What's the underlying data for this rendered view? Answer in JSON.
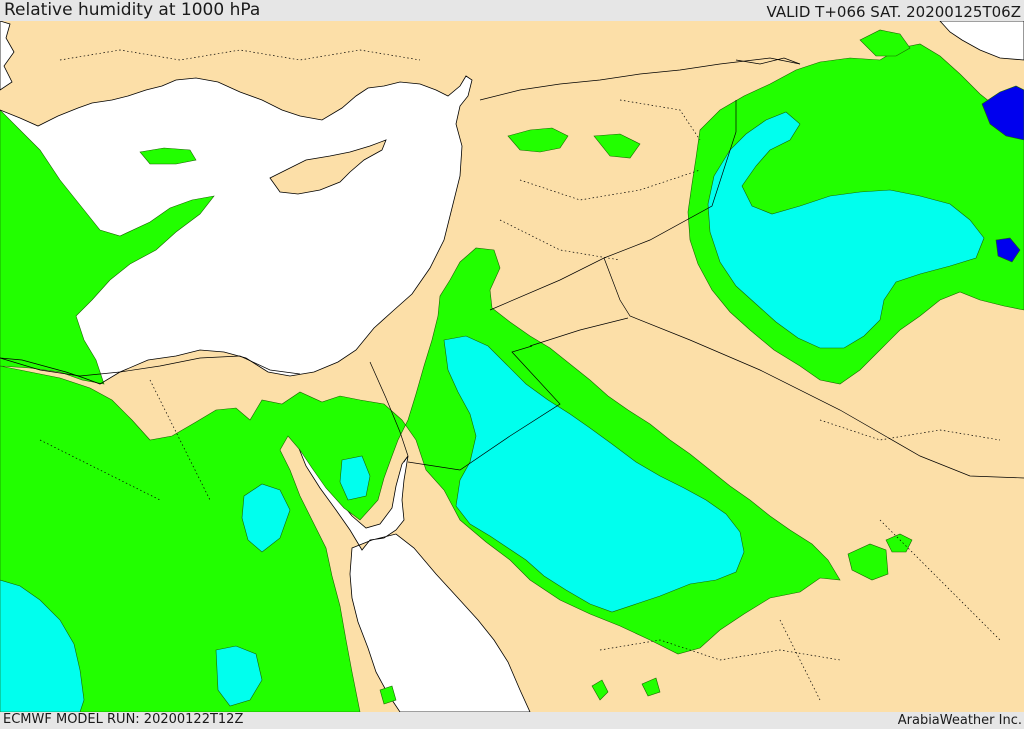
{
  "header": {
    "title": "Relative humidity at 1000 hPa",
    "valid": "VALID T+066 SAT. 20200125T06Z"
  },
  "footer": {
    "model_run": "ECMWF MODEL RUN: 20200122T12Z",
    "credit": "ArabiaWeather Inc."
  },
  "colors": {
    "land": "#fcdfa8",
    "sea": "#ffffff",
    "humidity_green": "#22ff00",
    "humidity_cyan": "#00ffee",
    "humidity_blue": "#0000ee",
    "frame": "#e6e6e6",
    "coastline": "#000000"
  }
}
